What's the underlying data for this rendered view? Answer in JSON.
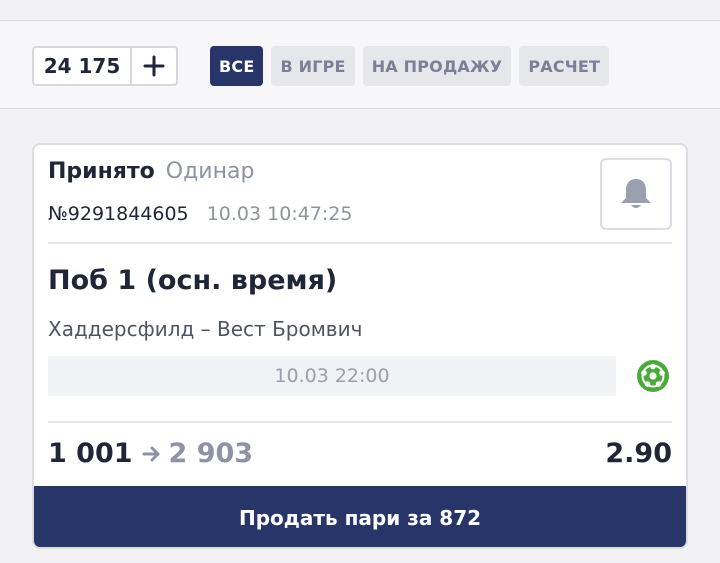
{
  "balance": {
    "value": "24 175",
    "plus_icon": "plus-icon"
  },
  "filters": [
    {
      "label": "ВСЕ",
      "active": true
    },
    {
      "label": "В ИГРЕ",
      "active": false
    },
    {
      "label": "НА ПРОДАЖУ",
      "active": false
    },
    {
      "label": "РАСЧЕТ",
      "active": false
    }
  ],
  "bet": {
    "status": "Принято",
    "type": "Одинар",
    "id": "№9291844605",
    "time": "10.03 10:47:25",
    "bell_icon": "bell-icon",
    "outcome": "Поб 1 (осн. время)",
    "match": "Хаддерсфилд – Вест Бромвич",
    "event_date": "10.03 22:00",
    "sport_icon": "football-icon",
    "stake": "1 001",
    "payout": "2 903",
    "coefficient": "2.90",
    "sell_label": "Продать пари за 872"
  },
  "colors": {
    "accent": "#283569",
    "muted": "#8d93a4",
    "sport": "#4caa3c"
  }
}
